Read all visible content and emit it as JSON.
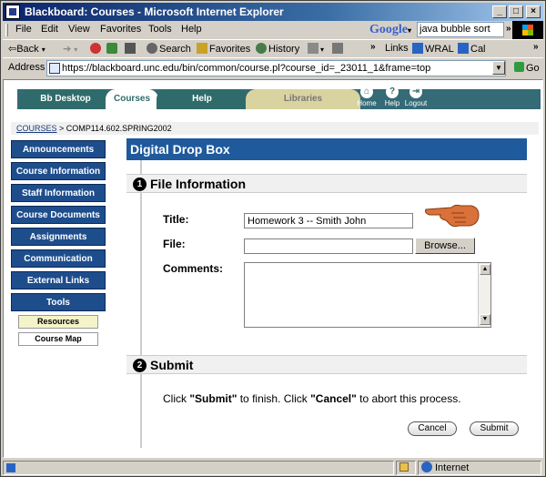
{
  "window": {
    "title": "Blackboard: Courses - Microsoft Internet Explorer",
    "controls": [
      "_",
      "□",
      "×"
    ]
  },
  "menubar": {
    "items": [
      "File",
      "Edit",
      "View",
      "Favorites",
      "Tools",
      "Help"
    ],
    "google_logo": "Google",
    "google_query": "java bubble sort"
  },
  "toolbar": {
    "back": "Back",
    "search": "Search",
    "favorites": "Favorites",
    "history": "History",
    "links_label": "Links",
    "link1": "WRAL",
    "link2": "Cal"
  },
  "address": {
    "label": "Address",
    "url": "https://blackboard.unc.edu/bin/common/course.pl?course_id=_23011_1&frame=top",
    "go": "Go"
  },
  "tabs": [
    "Bb Desktop",
    "Courses",
    "Help",
    "Libraries"
  ],
  "top_icons": [
    "Home",
    "Help",
    "Logout"
  ],
  "breadcrumb": {
    "link": "COURSES",
    "rest": " > COMP114.602.SPRING2002"
  },
  "course_menu": [
    "Announcements",
    "Course Information",
    "Staff Information",
    "Course Documents",
    "Assignments",
    "Communication",
    "External Links",
    "Tools"
  ],
  "sub_buttons": [
    "Resources",
    "Course Map"
  ],
  "page": {
    "title": "Digital Drop Box",
    "section1_num": "1",
    "section1": "File Information",
    "title_label": "Title:",
    "title_value": "Homework 3 -- Smith John",
    "file_label": "File:",
    "file_value": "",
    "browse": "Browse...",
    "comments_label": "Comments:",
    "section2_num": "2",
    "section2": "Submit",
    "instr_1": "Click ",
    "instr_submit": "\"Submit\"",
    "instr_2": " to finish. Click ",
    "instr_cancel": "\"Cancel\"",
    "instr_3": " to abort this process.",
    "cancel_button": "Cancel",
    "submit_button": "Submit"
  },
  "statusbar": {
    "zone": "Internet"
  },
  "colors": {
    "nav_blue": "#1e4d8c",
    "header_blue": "#1e5a9c",
    "tab_teal": "#2f6b6b"
  }
}
